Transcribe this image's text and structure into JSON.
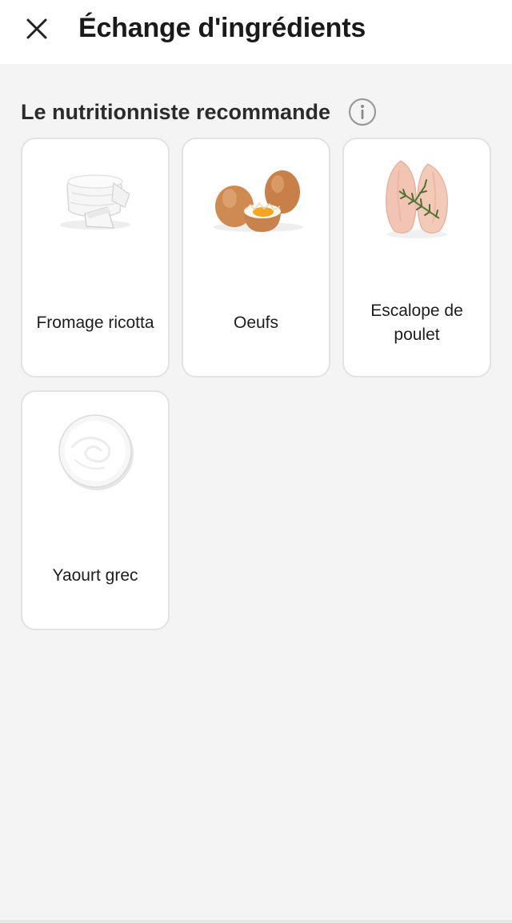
{
  "header": {
    "title": "Échange d'ingrédients",
    "close_icon": "close-icon"
  },
  "section": {
    "title": "Le nutritionniste recommande",
    "info_icon": "info-icon"
  },
  "items": [
    {
      "label": "Fromage ricotta",
      "image": "ricotta-cheese-image"
    },
    {
      "label": "Oeufs",
      "image": "eggs-image"
    },
    {
      "label": "Escalope de poulet",
      "image": "chicken-breast-image"
    },
    {
      "label": "Yaourt grec",
      "image": "greek-yogurt-image"
    }
  ]
}
